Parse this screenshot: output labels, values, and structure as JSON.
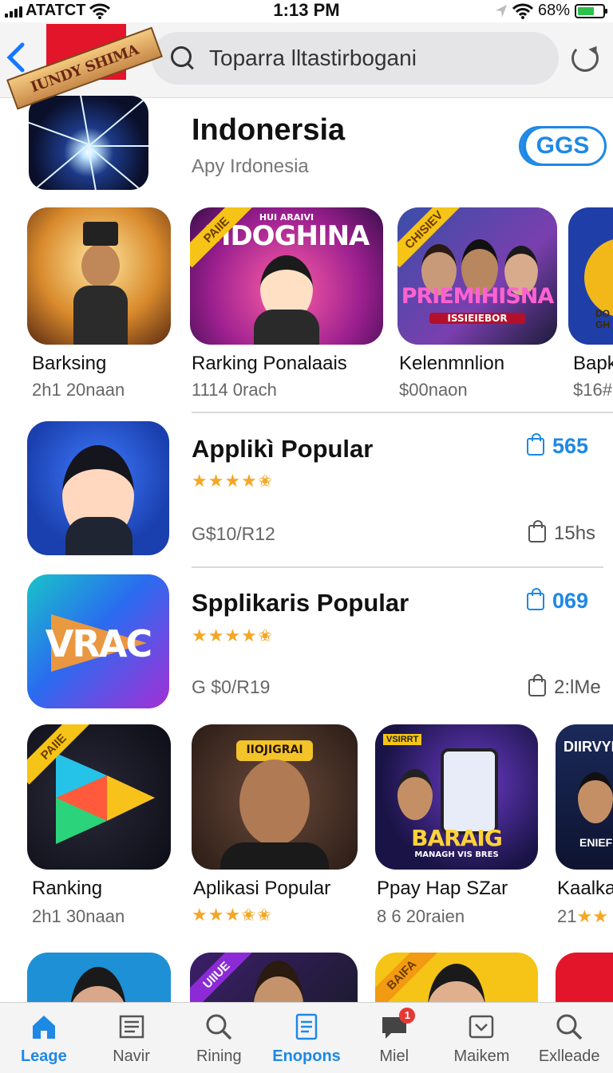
{
  "status_bar": {
    "carrier": "ATATCT",
    "time": "1:13 PM",
    "battery": "68%",
    "battery_level": 0.68
  },
  "header": {
    "search_query": "Toparra lltastirbogani"
  },
  "app": {
    "ribbon": "IUNDY SHIMA",
    "title": "Indonersia",
    "subtitle": "Apy Irdonesia",
    "action_label": "GGS"
  },
  "row1": [
    {
      "name": "Barksing",
      "meta": "2h1 20naan"
    },
    {
      "name": "Rarking Ponalaais",
      "meta": "1114 0rach",
      "corner": "PAIIE",
      "caption": "MDOGHINA",
      "caption_small": "HUI ARAIVI"
    },
    {
      "name": "Kelenmnlion",
      "meta": "$00naon",
      "corner": "CHISIEV",
      "caption": "PRIEMIHISNA",
      "caption_small": "ISSIEIEBOR"
    },
    {
      "name": "Bapk",
      "meta": "$16#",
      "caption_small": "DO GH"
    }
  ],
  "list": [
    {
      "title": "Applikì Popular",
      "stars": "★★★★✬",
      "count": "565",
      "price": "G$10/R12",
      "downloads": "15hs"
    },
    {
      "title": "Spplikaris Popular",
      "stars": "★★★★✬",
      "count": "069",
      "price": "G $0/R19",
      "downloads": "2:lMe",
      "icon_text": "VRAC"
    }
  ],
  "row2": [
    {
      "name": "Ranking",
      "meta": "2h1 30naan",
      "corner": "PAIIE"
    },
    {
      "name": "Aplikasi Popular",
      "stars": "★★★✬✬",
      "caption": "IIOJIGRAI"
    },
    {
      "name": "Ppay Hap SZar",
      "meta": "8 6 20raien",
      "caption": "BARAIG",
      "caption_small": "MANAGH VIS BRES",
      "corner": "VSIRRT"
    },
    {
      "name": "Kaalka",
      "meta": "21",
      "stars": "★★",
      "caption": "DIIRVYH",
      "caption_small": "ENIEF"
    }
  ],
  "row3": [
    {
      "corner": ""
    },
    {
      "corner": "UIIUE"
    },
    {
      "corner": "BAIFA"
    },
    {
      "corner": ""
    }
  ],
  "tabs": [
    {
      "label": "Leage",
      "icon": "home-icon",
      "active": true
    },
    {
      "label": "Navir",
      "icon": "news-icon"
    },
    {
      "label": "Rining",
      "icon": "search-icon"
    },
    {
      "label": "Enopons",
      "icon": "document-icon",
      "active": true
    },
    {
      "label": "Miel",
      "icon": "chat-icon",
      "badge": "1"
    },
    {
      "label": "Maikem",
      "icon": "inbox-icon"
    },
    {
      "label": "Exlleade",
      "icon": "search-icon"
    }
  ],
  "colors": {
    "accent": "#1e88e5",
    "star": "#f5a623",
    "badge": "#e53935",
    "corner_ribbon": "#f5c416"
  }
}
